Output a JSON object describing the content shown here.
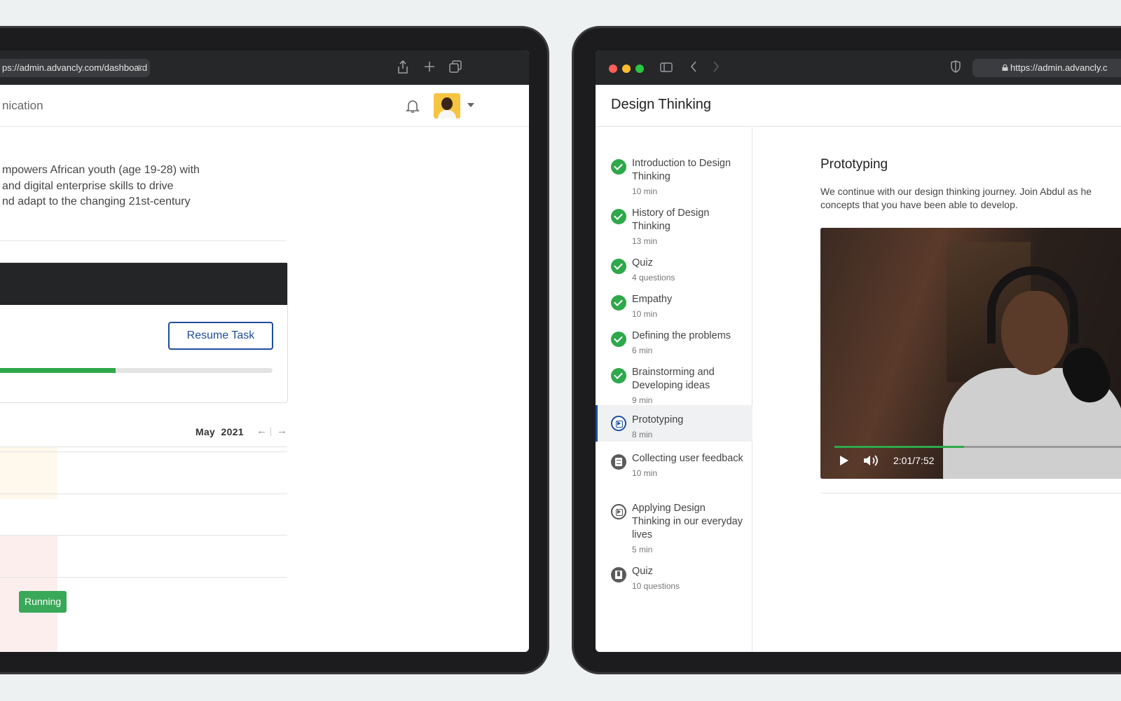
{
  "left": {
    "url": "ps://admin.advancly.com/dashboard",
    "header_partial": "nication",
    "description_lines": [
      "mpowers African youth (age 19-28) with",
      "and digital enterprise skills to drive",
      "nd adapt to the changing 21st-century"
    ],
    "resume_label": "Resume Task",
    "progress_fraction": 0.46,
    "calendar": {
      "month": "May",
      "year": "2021",
      "prev": "←",
      "next": "→"
    },
    "status_badge": "Running"
  },
  "right": {
    "url": "https://admin.advancly.c",
    "course_title": "Design Thinking",
    "lessons": [
      {
        "title": "Introduction to Design Thinking",
        "meta": "10 min",
        "status": "done"
      },
      {
        "title": "History of Design Thinking",
        "meta": "13 min",
        "status": "done"
      },
      {
        "title": "Quiz",
        "meta": "4 questions",
        "status": "done"
      },
      {
        "title": "Empathy",
        "meta": "10 min",
        "status": "done"
      },
      {
        "title": "Defining the problems",
        "meta": "6 min",
        "status": "done"
      },
      {
        "title": "Brainstorming and Developing ideas",
        "meta": "9 min",
        "status": "done"
      },
      {
        "title": "Prototyping",
        "meta": "8 min",
        "status": "current"
      },
      {
        "title": "Collecting user feedback",
        "meta": "10 min",
        "status": "document"
      },
      {
        "title": "Applying Design Thinking in our everyday lives",
        "meta": "5 min",
        "status": "video"
      },
      {
        "title": "Quiz",
        "meta": "10 questions",
        "status": "quiz"
      }
    ],
    "content_title": "Prototyping",
    "content_desc_lines": [
      "We continue with our design thinking journey. Join Abdul as he",
      "concepts that you have been able to develop."
    ],
    "video_time": "2:01/7:52",
    "video_progress_fraction": 0.42
  },
  "colors": {
    "accent": "#1f4e9c",
    "success": "#2ea84a",
    "chrome": "#262729",
    "traffic_red": "#fe5f57",
    "traffic_yellow": "#febc2e",
    "traffic_green": "#28c840"
  }
}
